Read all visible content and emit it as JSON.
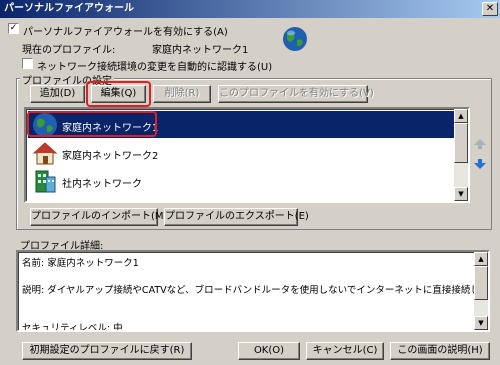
{
  "window": {
    "title": "パーソナルファイアウォール",
    "close_glyph": "✕"
  },
  "enable_firewall": {
    "checked": true,
    "label": "パーソナルファイアウォールを有効にする(A)"
  },
  "current_profile": {
    "label": "現在のプロファイル:",
    "value": "家庭内ネットワーク1"
  },
  "auto_detect": {
    "checked": false,
    "label": "ネットワーク接続環境の変更を自動的に認識する(U)"
  },
  "profile_settings": {
    "group_label": "プロファイルの設定",
    "buttons": {
      "add": "追加(D)",
      "edit": "編集(Q)",
      "delete": "削除(R)",
      "activate": "このプロファイルを有効にする(V)"
    },
    "items": [
      {
        "label": "家庭内ネットワーク1",
        "icon": "globe-icon",
        "selected": true
      },
      {
        "label": "家庭内ネットワーク2",
        "icon": "house-icon",
        "selected": false
      },
      {
        "label": "社内ネットワーク",
        "icon": "office-building-icon",
        "selected": false
      }
    ],
    "import_label": "プロファイルのインポート(M)",
    "export_label": "プロファイルのエクスポート(E)"
  },
  "details": {
    "label": "プロファイル詳細:",
    "name_line": "名前: 家庭内ネットワーク1",
    "description_line": "説明: ダイヤルアップ接続やCATVなど、ブロードバンドルータを使用しないでインターネットに直接接続している場合",
    "security_line": "セキュリティレベル: 中"
  },
  "footer": {
    "reset": "初期設定のプロファイルに戻す(R)",
    "ok": "OK(O)",
    "cancel": "キャンセル(C)",
    "help": "この画面の説明(H)"
  },
  "colors": {
    "selection": "#0a246a",
    "highlight": "#e02020",
    "titlebar": "#0a246a"
  }
}
